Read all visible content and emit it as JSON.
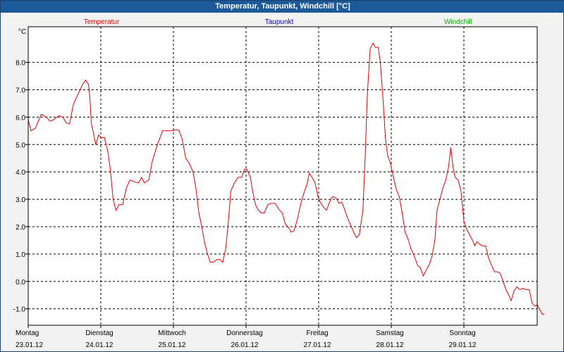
{
  "window": {
    "title": "Temperatur, Taupunkt, Windchill [°C]"
  },
  "chart_data": {
    "type": "line",
    "title": "Temperatur, Taupunkt, Windchill [°C]",
    "ylabel": "°C",
    "ylim": [
      -1.6,
      9.3
    ],
    "yticks": [
      -1.0,
      0.0,
      1.0,
      2.0,
      3.0,
      4.0,
      5.0,
      6.0,
      7.0,
      8.0
    ],
    "ytick_labels": [
      "-1.0",
      "0.0",
      "1.0",
      "2.0",
      "3.0",
      "4.0",
      "5.0",
      "6.0",
      "7.0",
      "8.0"
    ],
    "xlim": [
      0,
      7
    ],
    "grid": true,
    "legend": [
      {
        "name": "Temperatur",
        "color": "#e00000"
      },
      {
        "name": "Taupunkt",
        "color": "#0000c8"
      },
      {
        "name": "Windchill",
        "color": "#00b000"
      }
    ],
    "days": [
      {
        "weekday": "Montag",
        "date": "23.01.12"
      },
      {
        "weekday": "Dienstag",
        "date": "24.01.12"
      },
      {
        "weekday": "Mittwoch",
        "date": "25.01.12"
      },
      {
        "weekday": "Donnerstag",
        "date": "26.01.12"
      },
      {
        "weekday": "Freitag",
        "date": "27.01.12"
      },
      {
        "weekday": "Samstag",
        "date": "28.01.12"
      },
      {
        "weekday": "Sonntag",
        "date": "29.01.12"
      }
    ],
    "series": [
      {
        "name": "Temperatur",
        "color": "#e00000",
        "points": [
          [
            0.0,
            5.9
          ],
          [
            0.04,
            5.5
          ],
          [
            0.1,
            5.6
          ],
          [
            0.18,
            6.1
          ],
          [
            0.25,
            6.0
          ],
          [
            0.3,
            5.85
          ],
          [
            0.35,
            5.9
          ],
          [
            0.42,
            6.05
          ],
          [
            0.48,
            6.0
          ],
          [
            0.52,
            5.8
          ],
          [
            0.57,
            5.75
          ],
          [
            0.62,
            6.45
          ],
          [
            0.68,
            6.8
          ],
          [
            0.75,
            7.2
          ],
          [
            0.79,
            7.35
          ],
          [
            0.83,
            7.2
          ],
          [
            0.85,
            6.7
          ],
          [
            0.87,
            5.75
          ],
          [
            0.9,
            5.4
          ],
          [
            0.93,
            5.0
          ],
          [
            0.97,
            5.35
          ],
          [
            1.0,
            5.25
          ],
          [
            1.05,
            5.25
          ],
          [
            1.1,
            4.7
          ],
          [
            1.13,
            4.1
          ],
          [
            1.17,
            3.0
          ],
          [
            1.21,
            2.6
          ],
          [
            1.25,
            2.8
          ],
          [
            1.3,
            2.8
          ],
          [
            1.35,
            3.4
          ],
          [
            1.4,
            3.7
          ],
          [
            1.45,
            3.65
          ],
          [
            1.52,
            3.6
          ],
          [
            1.56,
            3.8
          ],
          [
            1.6,
            3.6
          ],
          [
            1.66,
            3.7
          ],
          [
            1.71,
            4.4
          ],
          [
            1.78,
            5.0
          ],
          [
            1.85,
            5.5
          ],
          [
            1.92,
            5.5
          ],
          [
            1.99,
            5.5
          ],
          [
            2.04,
            5.55
          ],
          [
            2.08,
            5.5
          ],
          [
            2.12,
            5.2
          ],
          [
            2.17,
            4.5
          ],
          [
            2.22,
            4.3
          ],
          [
            2.27,
            4.0
          ],
          [
            2.31,
            3.4
          ],
          [
            2.35,
            2.5
          ],
          [
            2.39,
            2.0
          ],
          [
            2.43,
            1.4
          ],
          [
            2.47,
            1.0
          ],
          [
            2.51,
            0.7
          ],
          [
            2.55,
            0.7
          ],
          [
            2.6,
            0.8
          ],
          [
            2.64,
            0.8
          ],
          [
            2.68,
            0.7
          ],
          [
            2.72,
            1.2
          ],
          [
            2.75,
            2.0
          ],
          [
            2.79,
            3.3
          ],
          [
            2.84,
            3.6
          ],
          [
            2.89,
            3.8
          ],
          [
            2.94,
            3.8
          ],
          [
            2.98,
            4.1
          ],
          [
            3.01,
            4.1
          ],
          [
            3.06,
            3.8
          ],
          [
            3.09,
            3.3
          ],
          [
            3.13,
            2.8
          ],
          [
            3.17,
            2.6
          ],
          [
            3.21,
            2.5
          ],
          [
            3.25,
            2.5
          ],
          [
            3.3,
            2.8
          ],
          [
            3.34,
            2.85
          ],
          [
            3.4,
            2.85
          ],
          [
            3.46,
            2.6
          ],
          [
            3.5,
            2.5
          ],
          [
            3.54,
            2.1
          ],
          [
            3.59,
            1.95
          ],
          [
            3.62,
            1.8
          ],
          [
            3.66,
            1.85
          ],
          [
            3.71,
            2.3
          ],
          [
            3.76,
            2.9
          ],
          [
            3.8,
            3.25
          ],
          [
            3.84,
            3.55
          ],
          [
            3.87,
            3.95
          ],
          [
            3.91,
            3.8
          ],
          [
            3.95,
            3.6
          ],
          [
            3.99,
            3.1
          ],
          [
            4.03,
            2.85
          ],
          [
            4.07,
            2.7
          ],
          [
            4.11,
            2.6
          ],
          [
            4.15,
            2.9
          ],
          [
            4.19,
            3.1
          ],
          [
            4.24,
            3.05
          ],
          [
            4.28,
            2.85
          ],
          [
            4.32,
            2.9
          ],
          [
            4.36,
            2.6
          ],
          [
            4.4,
            2.3
          ],
          [
            4.45,
            2.0
          ],
          [
            4.49,
            1.75
          ],
          [
            4.52,
            1.6
          ],
          [
            4.56,
            1.7
          ],
          [
            4.61,
            2.6
          ],
          [
            4.64,
            4.5
          ],
          [
            4.67,
            6.8
          ],
          [
            4.71,
            8.5
          ],
          [
            4.75,
            8.7
          ],
          [
            4.78,
            8.55
          ],
          [
            4.82,
            8.55
          ],
          [
            4.85,
            8.0
          ],
          [
            4.89,
            6.5
          ],
          [
            4.92,
            5.2
          ],
          [
            4.95,
            4.6
          ],
          [
            4.99,
            4.3
          ],
          [
            5.03,
            3.8
          ],
          [
            5.07,
            3.35
          ],
          [
            5.11,
            3.1
          ],
          [
            5.15,
            2.5
          ],
          [
            5.19,
            1.8
          ],
          [
            5.23,
            1.55
          ],
          [
            5.27,
            1.2
          ],
          [
            5.32,
            0.9
          ],
          [
            5.36,
            0.6
          ],
          [
            5.4,
            0.5
          ],
          [
            5.44,
            0.2
          ],
          [
            5.48,
            0.4
          ],
          [
            5.52,
            0.6
          ],
          [
            5.56,
            0.9
          ],
          [
            5.6,
            1.5
          ],
          [
            5.63,
            2.6
          ],
          [
            5.67,
            3.0
          ],
          [
            5.71,
            3.4
          ],
          [
            5.75,
            3.7
          ],
          [
            5.79,
            4.2
          ],
          [
            5.82,
            4.9
          ],
          [
            5.85,
            4.2
          ],
          [
            5.88,
            3.8
          ],
          [
            5.92,
            3.7
          ],
          [
            5.96,
            3.3
          ],
          [
            6.0,
            2.2
          ],
          [
            6.04,
            1.9
          ],
          [
            6.08,
            1.7
          ],
          [
            6.12,
            1.5
          ],
          [
            6.15,
            1.3
          ],
          [
            6.18,
            1.45
          ],
          [
            6.22,
            1.35
          ],
          [
            6.26,
            1.3
          ],
          [
            6.3,
            1.3
          ],
          [
            6.34,
            0.85
          ],
          [
            6.38,
            0.6
          ],
          [
            6.42,
            0.35
          ],
          [
            6.46,
            0.35
          ],
          [
            6.5,
            0.3
          ],
          [
            6.54,
            0.0
          ],
          [
            6.58,
            -0.3
          ],
          [
            6.61,
            -0.45
          ],
          [
            6.65,
            -0.7
          ],
          [
            6.69,
            -0.35
          ],
          [
            6.73,
            -0.2
          ],
          [
            6.77,
            -0.3
          ],
          [
            6.81,
            -0.25
          ],
          [
            6.86,
            -0.3
          ],
          [
            6.9,
            -0.3
          ],
          [
            6.94,
            -0.8
          ],
          [
            6.98,
            -0.9
          ],
          [
            7.01,
            -0.85
          ],
          [
            7.05,
            -1.05
          ],
          [
            7.08,
            -1.2
          ],
          [
            7.11,
            -1.2
          ]
        ]
      }
    ]
  }
}
